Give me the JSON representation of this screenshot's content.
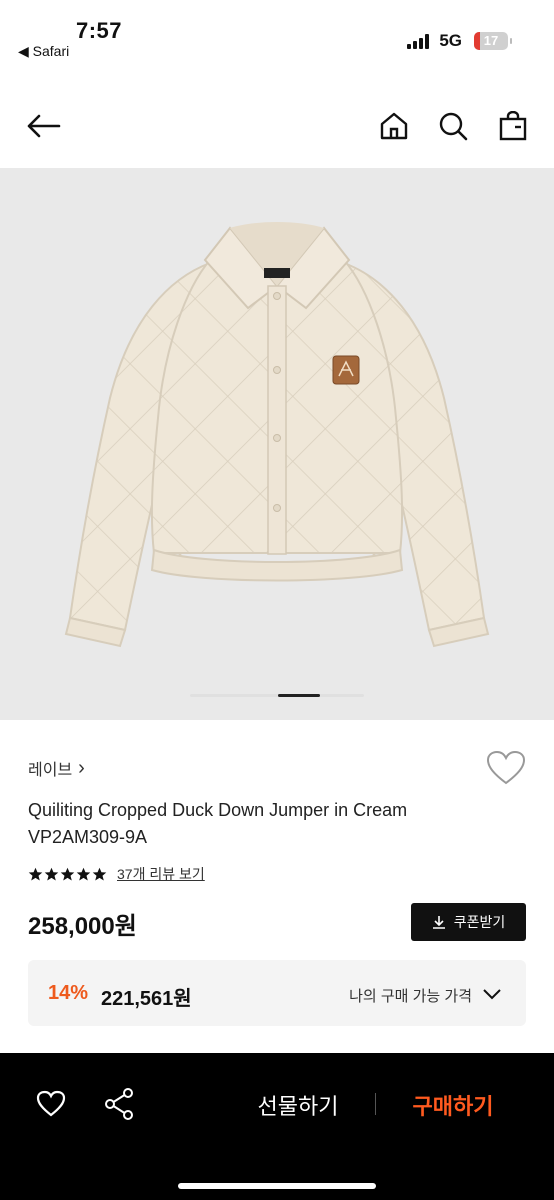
{
  "status_bar": {
    "time": "7:57",
    "back_app": "◀ Safari",
    "network": "5G",
    "battery": "17",
    "battery_level": 0.17,
    "battery_color": "#e23b31"
  },
  "header": {
    "icons": [
      "back-arrow-icon",
      "home-icon",
      "search-icon",
      "shopping-bag-icon"
    ]
  },
  "gallery": {
    "image_alt": "cream quilted cropped jacket",
    "patch_text": "RAVE",
    "current_slide": 4
  },
  "product": {
    "brand": "레이브",
    "brand_chevron": "›",
    "title_line1": "Quiliting Cropped Duck Down Jumper in Cream",
    "title_line2": "VP2AM309-9A",
    "rating_stars": 5,
    "review_link": "37개 리뷰 보기",
    "price": "258,000원",
    "coupon_label": "쿠폰받기"
  },
  "discount": {
    "rate": "14%",
    "price": "221,561원",
    "label": "나의 구매 가능 가격",
    "accent": "#ee5a1d"
  },
  "bottom_bar": {
    "gift_label": "선물하기",
    "buy_label": "구매하기",
    "buy_color": "#ff5a1f"
  }
}
